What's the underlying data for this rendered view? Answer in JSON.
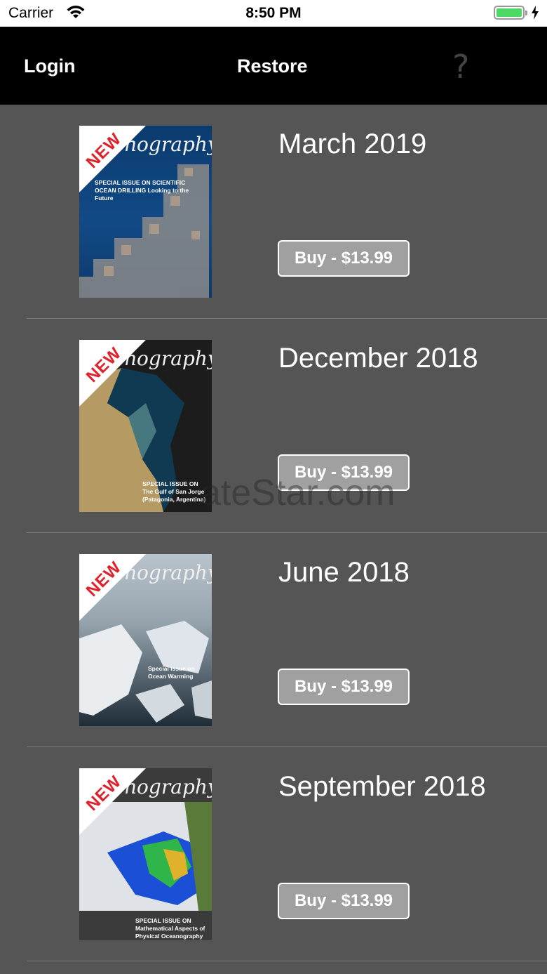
{
  "status_bar": {
    "carrier": "Carrier",
    "time": "8:50 PM"
  },
  "nav": {
    "login": "Login",
    "restore": "Restore",
    "help": "?"
  },
  "issues": [
    {
      "title": "March 2019",
      "buy_label": "Buy - $13.99",
      "badge": "NEW",
      "masthead": "nography",
      "cover_text": "SPECIAL ISSUE ON SCIENTIFIC OCEAN DRILLING Looking to the Future"
    },
    {
      "title": "December 2018",
      "buy_label": "Buy - $13.99",
      "badge": "NEW",
      "masthead": "nography",
      "cover_text": "SPECIAL ISSUE ON The Gulf of San Jorge (Patagonia, Argentina)"
    },
    {
      "title": "June 2018",
      "buy_label": "Buy - $13.99",
      "badge": "NEW",
      "masthead": "nography",
      "cover_text": "Special Issue on Ocean Warming"
    },
    {
      "title": "September 2018",
      "buy_label": "Buy - $13.99",
      "badge": "NEW",
      "masthead": "nography",
      "cover_text": "SPECIAL ISSUE ON Mathematical Aspects of Physical Oceanography"
    }
  ],
  "watermark": "ateStar.com"
}
